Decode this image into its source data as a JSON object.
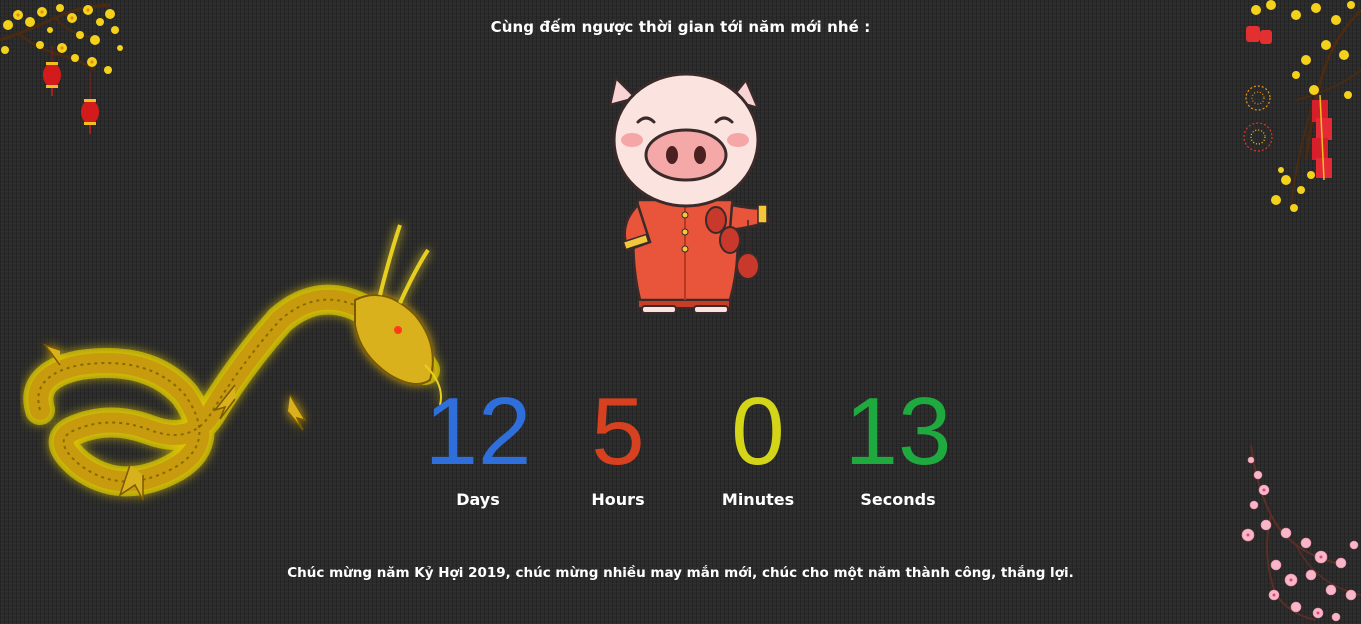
{
  "header": {
    "text": "Cùng đếm ngược thời gian tới năm mới nhé :"
  },
  "countdown": {
    "days": {
      "value": "12",
      "label": "Days",
      "color": "#2f6fdc"
    },
    "hours": {
      "value": "5",
      "label": "Hours",
      "color": "#d8411f"
    },
    "minutes": {
      "value": "0",
      "label": "Minutes",
      "color": "#d4d419"
    },
    "seconds": {
      "value": "13",
      "label": "Seconds",
      "color": "#1faa3f"
    }
  },
  "footer": {
    "text": "Chúc mừng năm Kỷ Hợi 2019, chúc mừng nhiều may mắn mới, chúc cho một năm thành công, thắng lợi."
  },
  "decorations": {
    "top_left": "apricot-blossom-lanterns",
    "top_right": "apricot-blossom-firecrackers",
    "bottom_right": "peach-blossom",
    "left": "golden-dragon",
    "center": "pig-mascot"
  }
}
